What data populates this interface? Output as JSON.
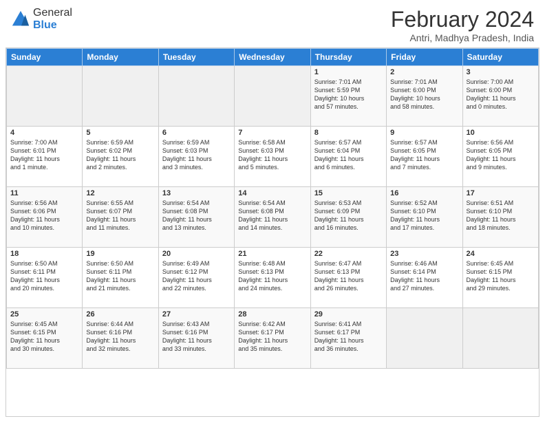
{
  "logo": {
    "general": "General",
    "blue": "Blue"
  },
  "header": {
    "title": "February 2024",
    "subtitle": "Antri, Madhya Pradesh, India"
  },
  "days_of_week": [
    "Sunday",
    "Monday",
    "Tuesday",
    "Wednesday",
    "Thursday",
    "Friday",
    "Saturday"
  ],
  "weeks": [
    [
      {
        "day": "",
        "info": ""
      },
      {
        "day": "",
        "info": ""
      },
      {
        "day": "",
        "info": ""
      },
      {
        "day": "",
        "info": ""
      },
      {
        "day": "1",
        "info": "Sunrise: 7:01 AM\nSunset: 5:59 PM\nDaylight: 10 hours\nand 57 minutes."
      },
      {
        "day": "2",
        "info": "Sunrise: 7:01 AM\nSunset: 6:00 PM\nDaylight: 10 hours\nand 58 minutes."
      },
      {
        "day": "3",
        "info": "Sunrise: 7:00 AM\nSunset: 6:00 PM\nDaylight: 11 hours\nand 0 minutes."
      }
    ],
    [
      {
        "day": "4",
        "info": "Sunrise: 7:00 AM\nSunset: 6:01 PM\nDaylight: 11 hours\nand 1 minute."
      },
      {
        "day": "5",
        "info": "Sunrise: 6:59 AM\nSunset: 6:02 PM\nDaylight: 11 hours\nand 2 minutes."
      },
      {
        "day": "6",
        "info": "Sunrise: 6:59 AM\nSunset: 6:03 PM\nDaylight: 11 hours\nand 3 minutes."
      },
      {
        "day": "7",
        "info": "Sunrise: 6:58 AM\nSunset: 6:03 PM\nDaylight: 11 hours\nand 5 minutes."
      },
      {
        "day": "8",
        "info": "Sunrise: 6:57 AM\nSunset: 6:04 PM\nDaylight: 11 hours\nand 6 minutes."
      },
      {
        "day": "9",
        "info": "Sunrise: 6:57 AM\nSunset: 6:05 PM\nDaylight: 11 hours\nand 7 minutes."
      },
      {
        "day": "10",
        "info": "Sunrise: 6:56 AM\nSunset: 6:05 PM\nDaylight: 11 hours\nand 9 minutes."
      }
    ],
    [
      {
        "day": "11",
        "info": "Sunrise: 6:56 AM\nSunset: 6:06 PM\nDaylight: 11 hours\nand 10 minutes."
      },
      {
        "day": "12",
        "info": "Sunrise: 6:55 AM\nSunset: 6:07 PM\nDaylight: 11 hours\nand 11 minutes."
      },
      {
        "day": "13",
        "info": "Sunrise: 6:54 AM\nSunset: 6:08 PM\nDaylight: 11 hours\nand 13 minutes."
      },
      {
        "day": "14",
        "info": "Sunrise: 6:54 AM\nSunset: 6:08 PM\nDaylight: 11 hours\nand 14 minutes."
      },
      {
        "day": "15",
        "info": "Sunrise: 6:53 AM\nSunset: 6:09 PM\nDaylight: 11 hours\nand 16 minutes."
      },
      {
        "day": "16",
        "info": "Sunrise: 6:52 AM\nSunset: 6:10 PM\nDaylight: 11 hours\nand 17 minutes."
      },
      {
        "day": "17",
        "info": "Sunrise: 6:51 AM\nSunset: 6:10 PM\nDaylight: 11 hours\nand 18 minutes."
      }
    ],
    [
      {
        "day": "18",
        "info": "Sunrise: 6:50 AM\nSunset: 6:11 PM\nDaylight: 11 hours\nand 20 minutes."
      },
      {
        "day": "19",
        "info": "Sunrise: 6:50 AM\nSunset: 6:11 PM\nDaylight: 11 hours\nand 21 minutes."
      },
      {
        "day": "20",
        "info": "Sunrise: 6:49 AM\nSunset: 6:12 PM\nDaylight: 11 hours\nand 22 minutes."
      },
      {
        "day": "21",
        "info": "Sunrise: 6:48 AM\nSunset: 6:13 PM\nDaylight: 11 hours\nand 24 minutes."
      },
      {
        "day": "22",
        "info": "Sunrise: 6:47 AM\nSunset: 6:13 PM\nDaylight: 11 hours\nand 26 minutes."
      },
      {
        "day": "23",
        "info": "Sunrise: 6:46 AM\nSunset: 6:14 PM\nDaylight: 11 hours\nand 27 minutes."
      },
      {
        "day": "24",
        "info": "Sunrise: 6:45 AM\nSunset: 6:15 PM\nDaylight: 11 hours\nand 29 minutes."
      }
    ],
    [
      {
        "day": "25",
        "info": "Sunrise: 6:45 AM\nSunset: 6:15 PM\nDaylight: 11 hours\nand 30 minutes."
      },
      {
        "day": "26",
        "info": "Sunrise: 6:44 AM\nSunset: 6:16 PM\nDaylight: 11 hours\nand 32 minutes."
      },
      {
        "day": "27",
        "info": "Sunrise: 6:43 AM\nSunset: 6:16 PM\nDaylight: 11 hours\nand 33 minutes."
      },
      {
        "day": "28",
        "info": "Sunrise: 6:42 AM\nSunset: 6:17 PM\nDaylight: 11 hours\nand 35 minutes."
      },
      {
        "day": "29",
        "info": "Sunrise: 6:41 AM\nSunset: 6:17 PM\nDaylight: 11 hours\nand 36 minutes."
      },
      {
        "day": "",
        "info": ""
      },
      {
        "day": "",
        "info": ""
      }
    ]
  ]
}
